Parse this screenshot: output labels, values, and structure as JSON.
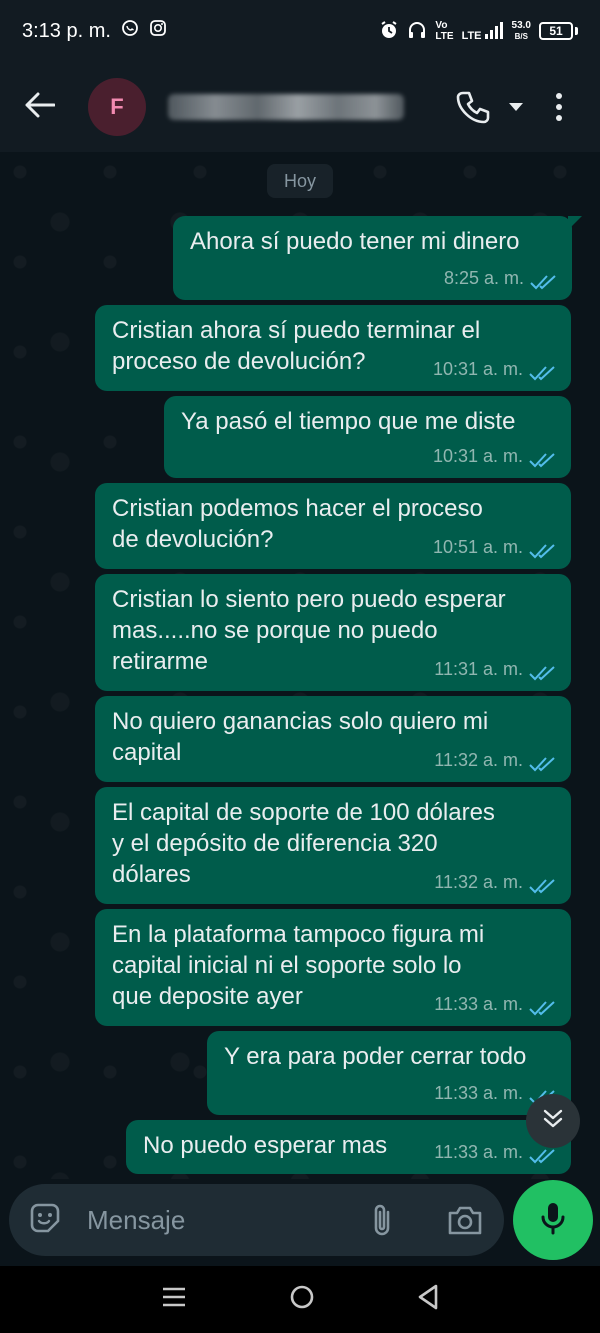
{
  "status_bar": {
    "time": "3:13 p. m.",
    "network_speed": "53.0",
    "network_unit": "B/S",
    "battery": "51",
    "volte_top": "Vo",
    "volte_bottom": "LTE",
    "lte": "LTE"
  },
  "header": {
    "avatar_initial": "F",
    "contact_name": "redacted"
  },
  "chat": {
    "date_divider": "Hoy",
    "messages": [
      {
        "text": "Ahora sí puedo tener mi dinero",
        "time": "8:25 a. m."
      },
      {
        "text": "Cristian ahora sí puedo terminar el\nproceso de devolución?",
        "time": "10:31 a. m."
      },
      {
        "text": "Ya pasó el tiempo que me diste",
        "time": "10:31 a. m."
      },
      {
        "text": "Cristian podemos hacer el proceso\nde devolución?",
        "time": "10:51 a. m."
      },
      {
        "text": "Cristian lo siento pero puedo esperar\nmas.....no se porque no puedo\nretirarme",
        "time": "11:31 a. m."
      },
      {
        "text": "No quiero ganancias solo quiero mi\ncapital",
        "time": "11:32 a. m."
      },
      {
        "text": "El capital de soporte de 100 dólares\ny el depósito de diferencia 320\ndólares",
        "time": "11:32 a. m."
      },
      {
        "text": "En la plataforma tampoco figura mi\ncapital inicial ni el soporte solo lo\nque deposite ayer",
        "time": "11:33 a. m."
      },
      {
        "text": "Y era para poder cerrar todo",
        "time": "11:33 a. m."
      },
      {
        "text": "No puedo esperar mas",
        "time": "11:33 a. m."
      }
    ]
  },
  "compose": {
    "placeholder": "Mensaje"
  },
  "colors": {
    "bubble_out": "#005c4b",
    "read_ticks": "#53bdeb",
    "mic_button": "#21c063",
    "background": "#0b141a",
    "header": "#121b22"
  },
  "icons": {
    "back": "arrow-left-icon",
    "call": "phone-icon",
    "dropdown": "caret-down-icon",
    "menu": "kebab-menu-icon",
    "sticker": "sticker-icon",
    "attach": "paperclip-icon",
    "camera": "camera-icon",
    "mic": "microphone-icon",
    "scroll_down": "double-chevron-down-icon",
    "read_receipt": "double-check-icon"
  }
}
